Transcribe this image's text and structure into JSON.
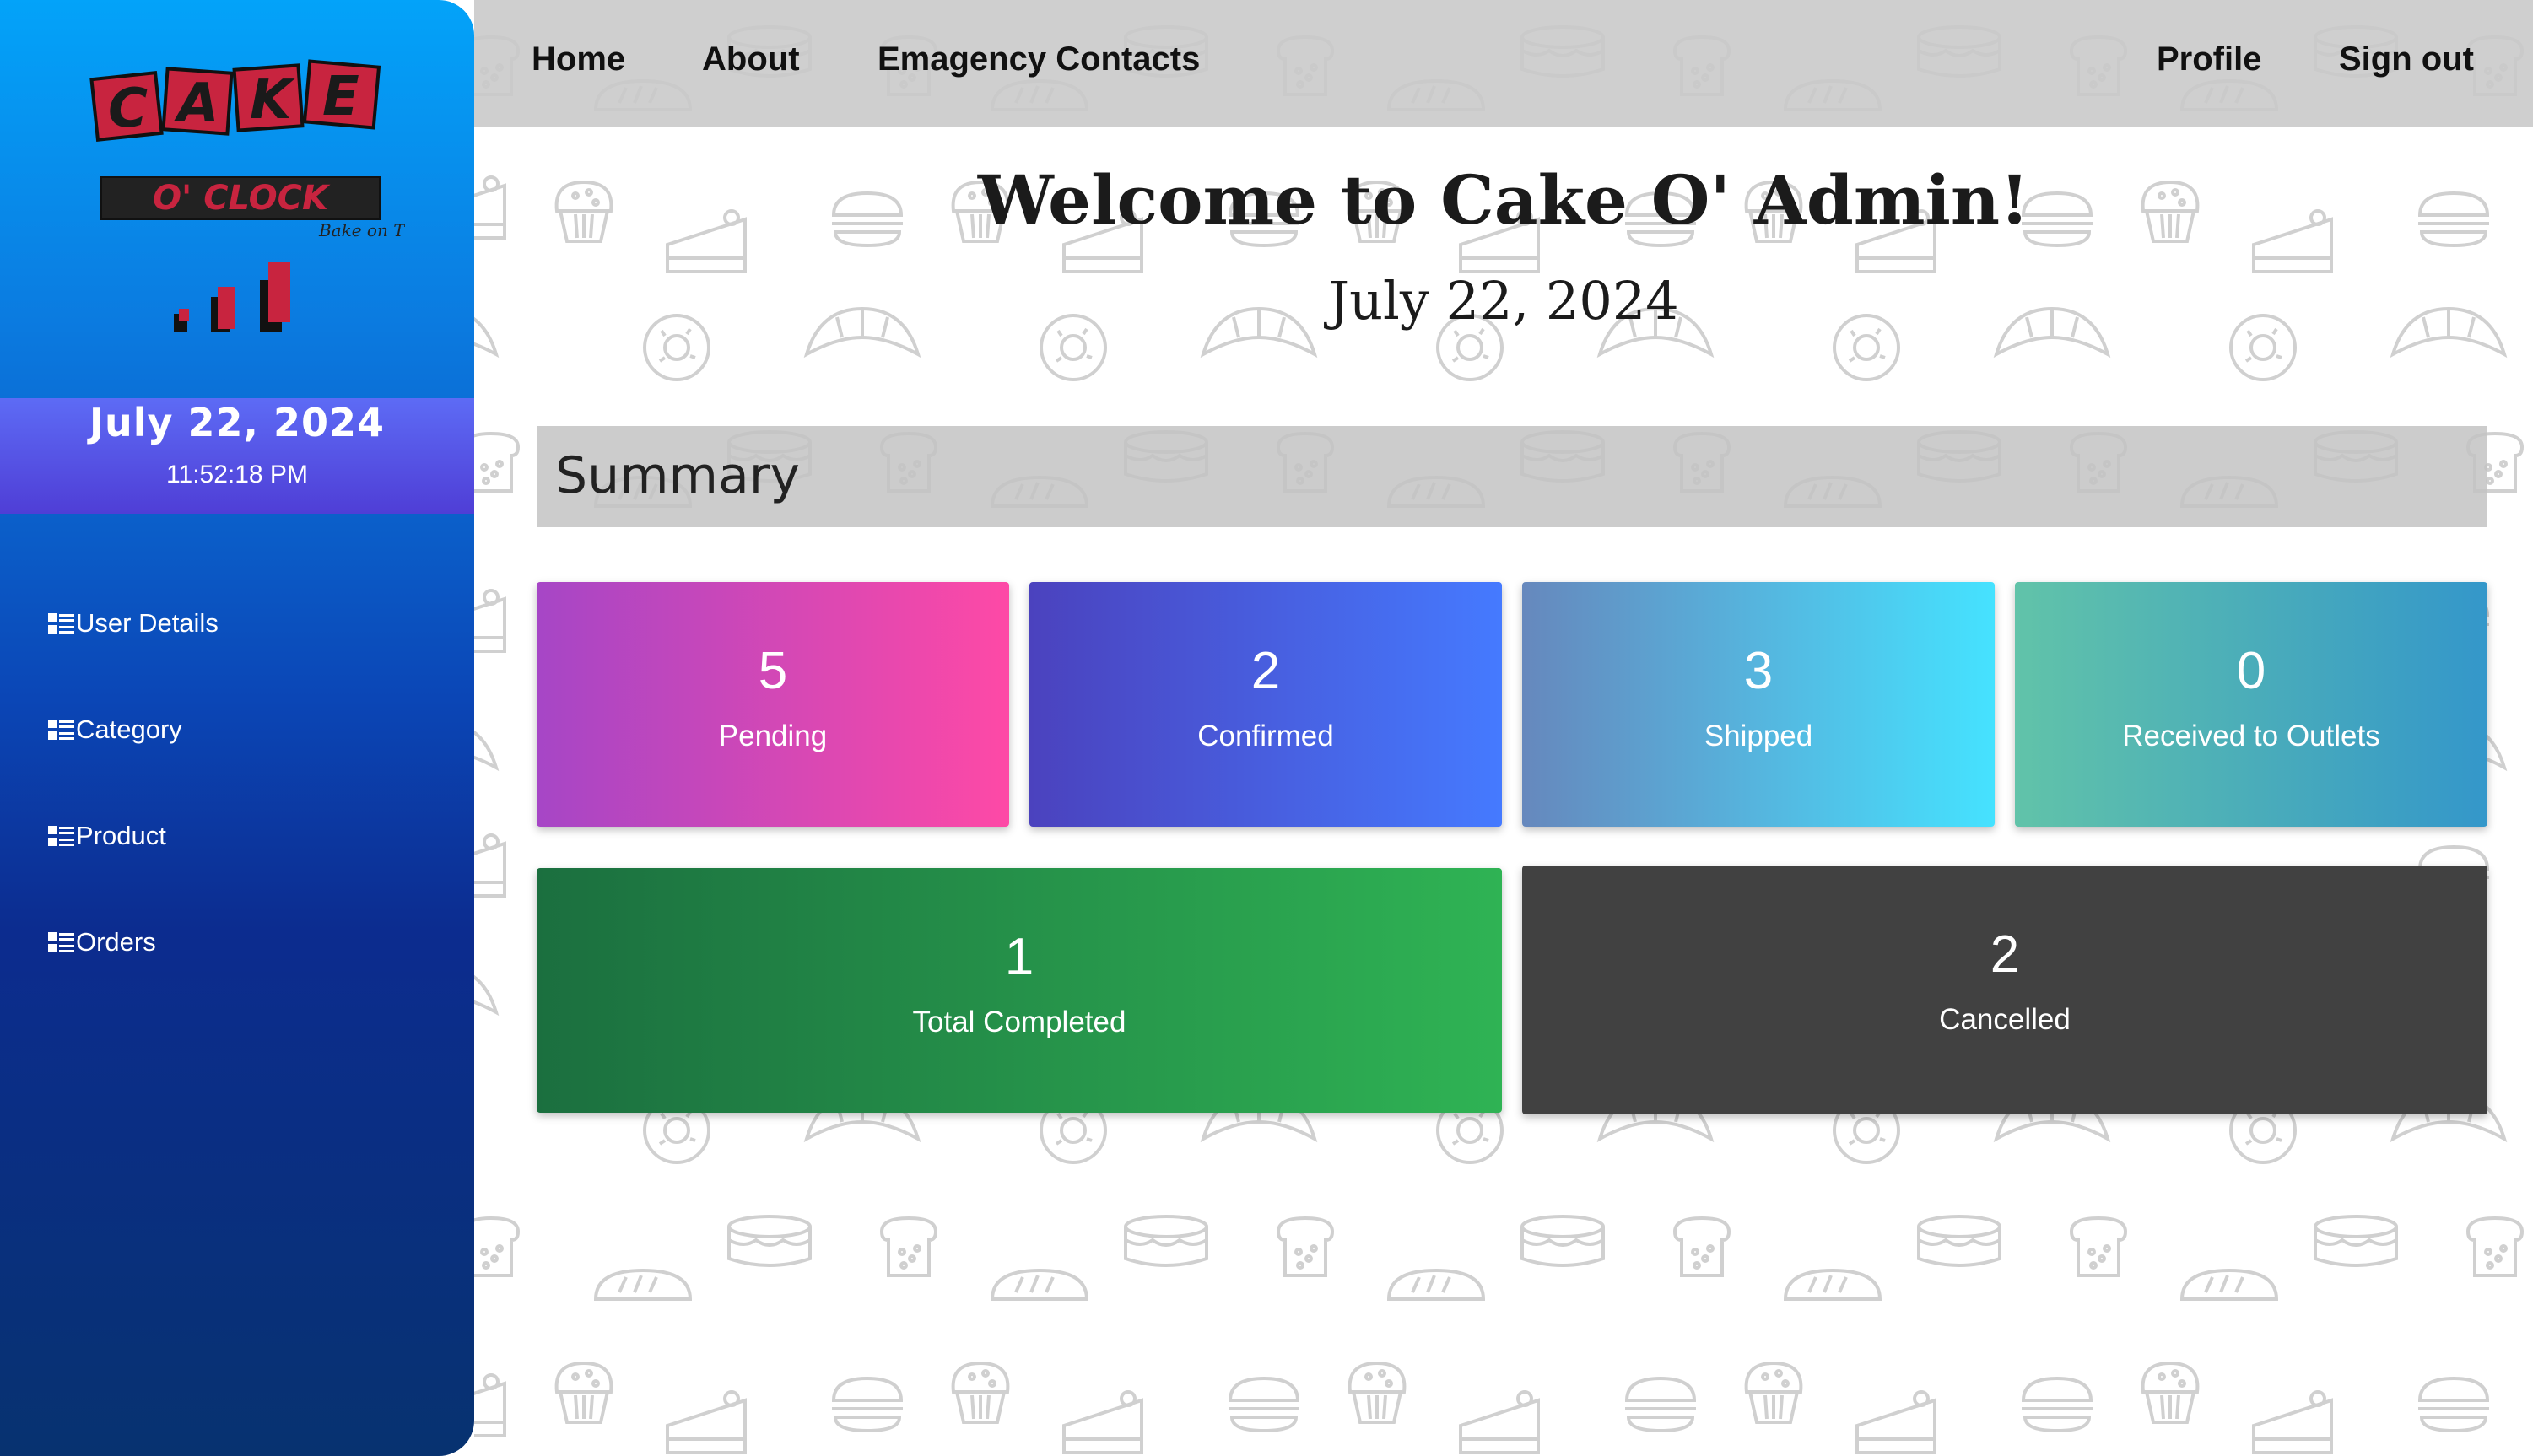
{
  "sidebar": {
    "logo": {
      "word": "CAKE",
      "sub": "O' CLOCK",
      "tagline": "Bake on Time"
    },
    "date": "July 22, 2024",
    "time": "11:52:18 PM",
    "items": [
      {
        "label": "User Details",
        "icon": "list-icon"
      },
      {
        "label": "Category",
        "icon": "list-icon"
      },
      {
        "label": "Product",
        "icon": "list-icon"
      },
      {
        "label": "Orders",
        "icon": "list-icon"
      }
    ]
  },
  "topnav": {
    "left": [
      "Home",
      "About",
      "Emagency Contacts"
    ],
    "right": [
      "Profile",
      "Sign out"
    ]
  },
  "header": {
    "title": "Welcome to Cake O' Admin!",
    "date": "July 22, 2024"
  },
  "summary": {
    "title": "Summary",
    "cards": [
      {
        "value": "5",
        "label": "Pending"
      },
      {
        "value": "2",
        "label": "Confirmed"
      },
      {
        "value": "3",
        "label": "Shipped"
      },
      {
        "value": "0",
        "label": "Received to Outlets"
      },
      {
        "value": "1",
        "label": "Total Completed"
      },
      {
        "value": "2",
        "label": "Cancelled"
      }
    ]
  },
  "colors": {
    "sidebar_top": "#03a3f9",
    "sidebar_bottom": "#073270",
    "date_band": "#5d6bf5",
    "pending": [
      "#a646c6",
      "#fe49a6"
    ],
    "confirmed": [
      "#4b42be",
      "#457aff"
    ],
    "shipped": [
      "#6688bd",
      "#45e2ff"
    ],
    "received": [
      "#61c3a9",
      "#3497ca"
    ],
    "completed": [
      "#1b6f3f",
      "#2fb354"
    ],
    "cancelled": "#414141"
  }
}
